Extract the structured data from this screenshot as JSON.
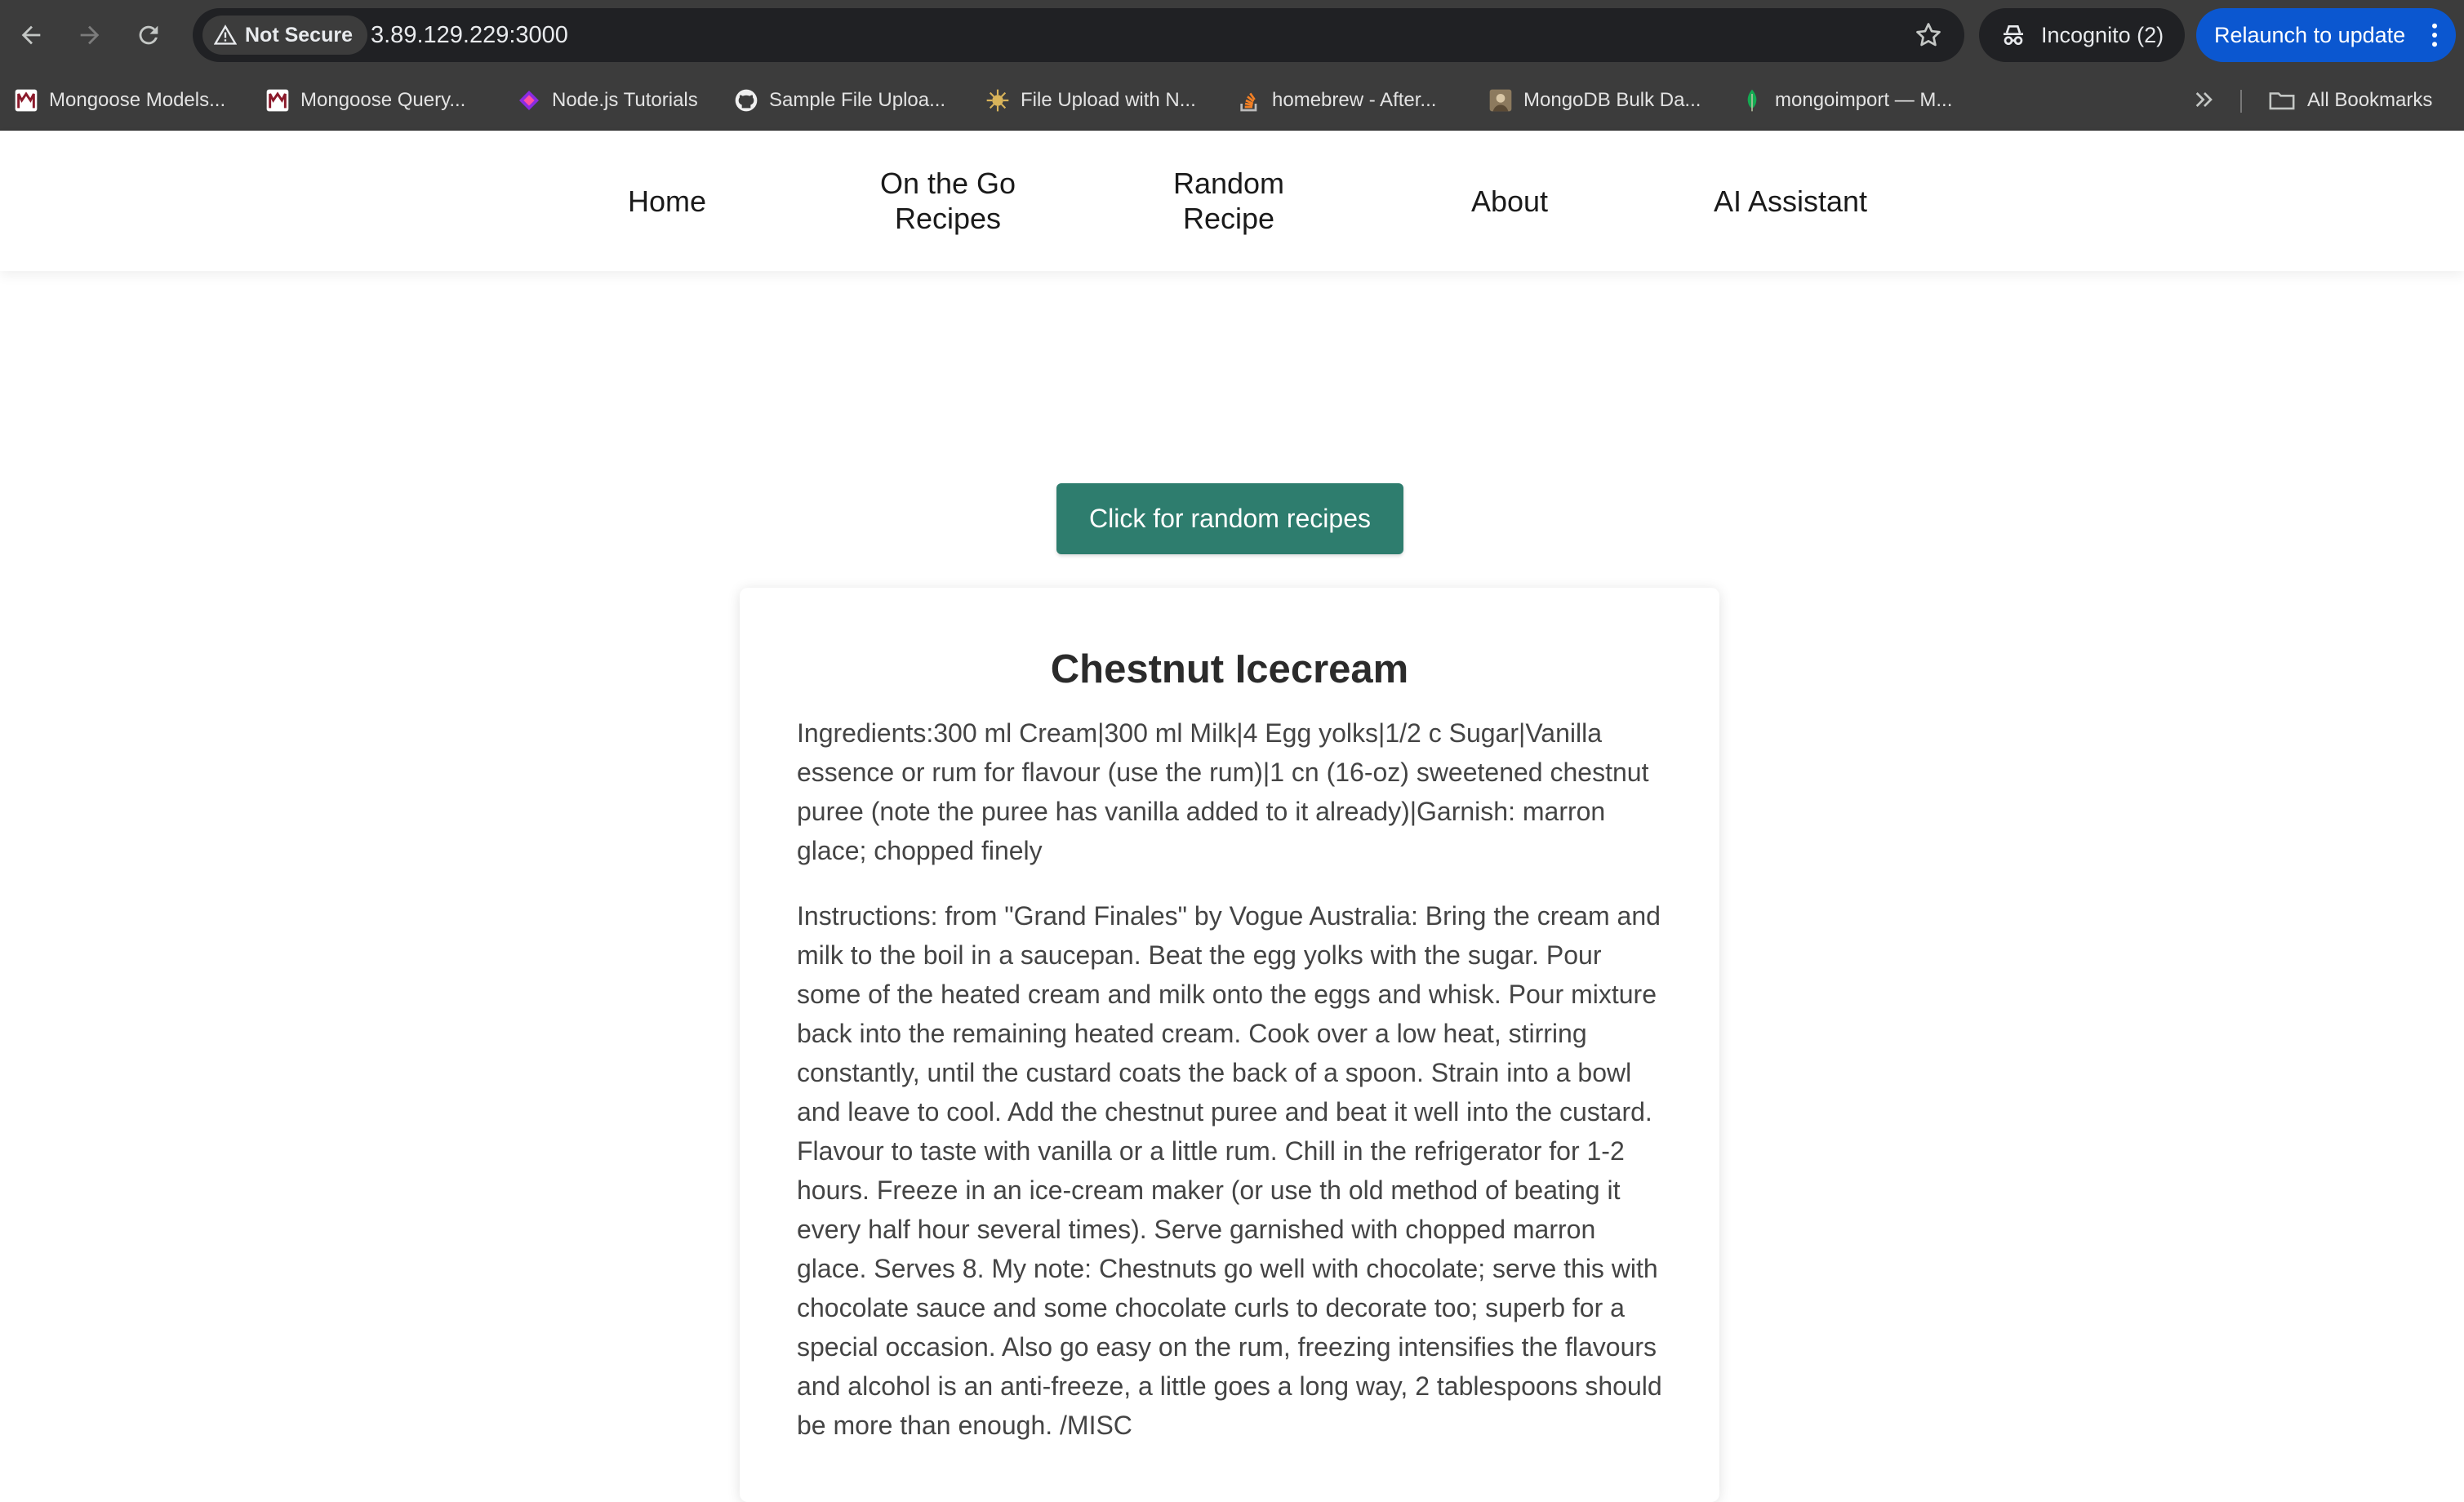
{
  "browser": {
    "security_label": "Not Secure",
    "url": "3.89.129.229:3000",
    "incognito_label": "Incognito (2)",
    "relaunch_label": "Relaunch to update",
    "bookmarks": [
      {
        "label": "Mongoose Models...",
        "icon": "mongoose-icon"
      },
      {
        "label": "Mongoose Query...",
        "icon": "mongoose-icon"
      },
      {
        "label": "Node.js Tutorials",
        "icon": "nodejs-tutorials-icon"
      },
      {
        "label": "Sample File Uploa...",
        "icon": "github-icon"
      },
      {
        "label": "File Upload with N...",
        "icon": "bug-icon"
      },
      {
        "label": "homebrew - After...",
        "icon": "stack-overflow-icon"
      },
      {
        "label": "MongoDB Bulk Da...",
        "icon": "avatar-icon"
      },
      {
        "label": "mongoimport — M...",
        "icon": "mongodb-leaf-icon"
      }
    ],
    "all_bookmarks_label": "All Bookmarks"
  },
  "site_nav": {
    "items": [
      {
        "label": "Home"
      },
      {
        "label": "On the Go Recipes"
      },
      {
        "label": "Random Recipe"
      },
      {
        "label": "About"
      },
      {
        "label": "AI Assistant"
      }
    ]
  },
  "main": {
    "random_button_label": "Click for random recipes",
    "recipe": {
      "title": "Chestnut Icecream",
      "ingredients": "Ingredients:300 ml Cream|300 ml Milk|4 Egg yolks|1/2 c Sugar|Vanilla essence or rum for flavour (use the rum)|1 cn (16-oz) sweetened chestnut puree (note the puree has vanilla added to it already)|Garnish: marron glace; chopped finely",
      "instructions": "Instructions: from \"Grand Finales\" by Vogue Australia: Bring the cream and milk to the boil in a saucepan. Beat the egg yolks with the sugar. Pour some of the heated cream and milk onto the eggs and whisk. Pour mixture back into the remaining heated cream. Cook over a low heat, stirring constantly, until the custard coats the back of a spoon. Strain into a bowl and leave to cool. Add the chestnut puree and beat it well into the custard. Flavour to taste with vanilla or a little rum. Chill in the refrigerator for 1-2 hours. Freeze in an ice-cream maker (or use th old method of beating it every half hour several times). Serve garnished with chopped marron glace. Serves 8. My note: Chestnuts go well with chocolate; serve this with chocolate sauce and some chocolate curls to decorate too; superb for a special occasion. Also go easy on the rum, freezing intensifies the flavours and alcohol is an anti-freeze, a little goes a long way, 2 tablespoons should be more than enough. /MISC"
    }
  },
  "colors": {
    "chrome_bg": "#3c3c3c",
    "omnibox_bg": "#202124",
    "relaunch_blue": "#0b57d0",
    "button_teal": "#2e7d6e"
  }
}
